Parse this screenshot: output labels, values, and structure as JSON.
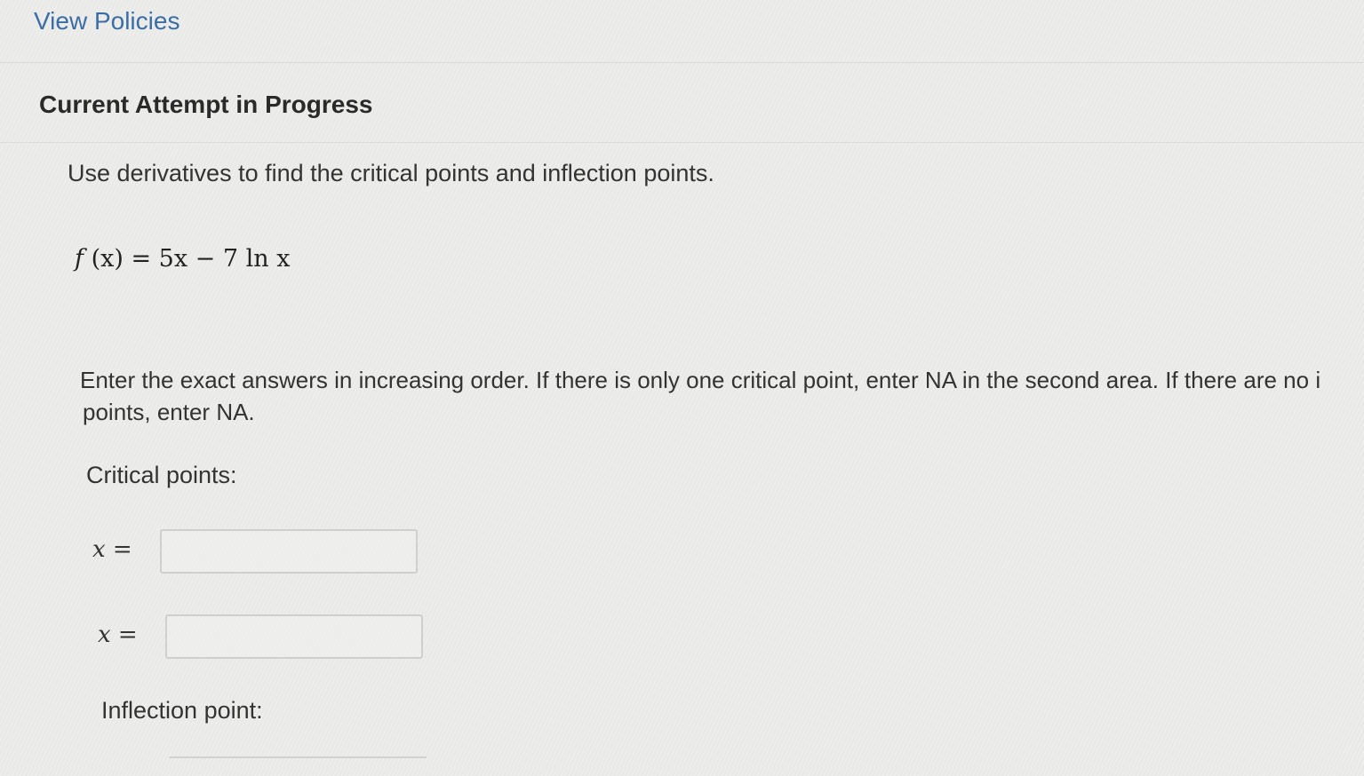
{
  "header": {
    "view_policies": "View Policies"
  },
  "attempt": {
    "title": "Current Attempt in Progress"
  },
  "question": {
    "instruction": "Use derivatives to find the critical points and inflection points.",
    "formula": {
      "fn": "f",
      "rest": " (x) = 5x − 7 ln x"
    },
    "directions_line1": "Enter the exact answers in increasing order. If there is only one critical point, enter NA in the second area. If there are no i",
    "directions_line2": "points, enter NA."
  },
  "critical": {
    "label": "Critical points:",
    "var": "x",
    "eq": " =",
    "inputs": [
      {
        "value": "",
        "placeholder": ""
      },
      {
        "value": "",
        "placeholder": ""
      }
    ]
  },
  "inflection": {
    "label": "Inflection point:"
  }
}
